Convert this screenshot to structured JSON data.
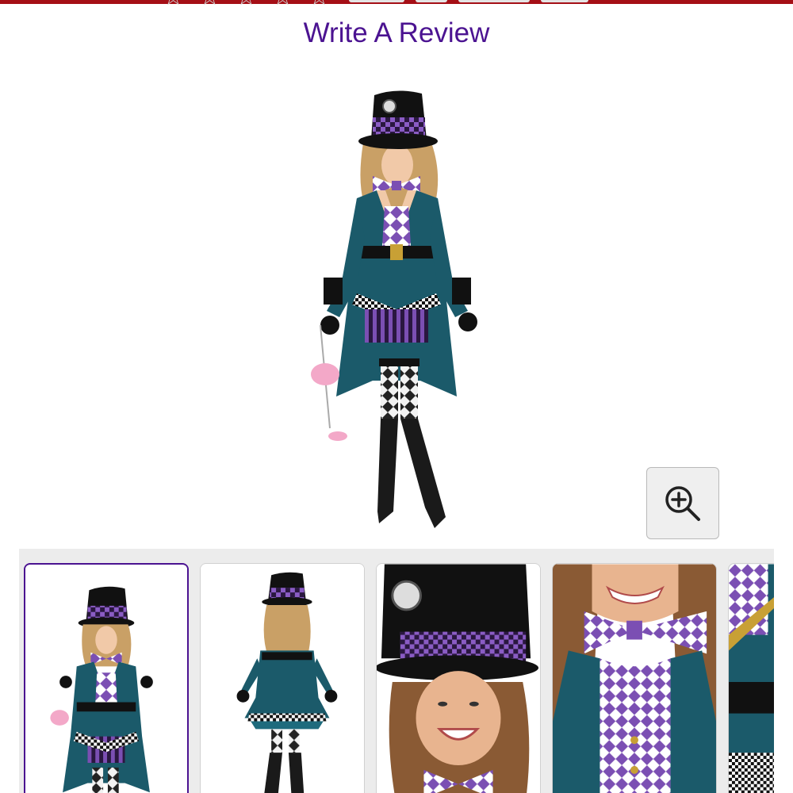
{
  "header": {
    "accent_color": "#a50f16",
    "star_icon": "star-outline-icon",
    "star_glyph": "☆",
    "star_count": 5
  },
  "review": {
    "write_review_label": "Write A Review",
    "link_color": "#4b1391"
  },
  "product_image": {
    "icon": "mad-hatter-costume-image"
  },
  "zoom": {
    "icon": "zoom-in-icon"
  },
  "thumbnails": {
    "selected_index": 0,
    "items": [
      {
        "icon": "front-view-thumbnail"
      },
      {
        "icon": "back-view-thumbnail"
      },
      {
        "icon": "hat-closeup-thumbnail"
      },
      {
        "icon": "bowtie-closeup-thumbnail"
      },
      {
        "icon": "jacket-detail-thumbnail"
      }
    ]
  },
  "colors": {
    "purple": "#7b4fb3",
    "lavender": "#c9a8ee",
    "teal": "#1b5a6a",
    "black": "#111111"
  }
}
